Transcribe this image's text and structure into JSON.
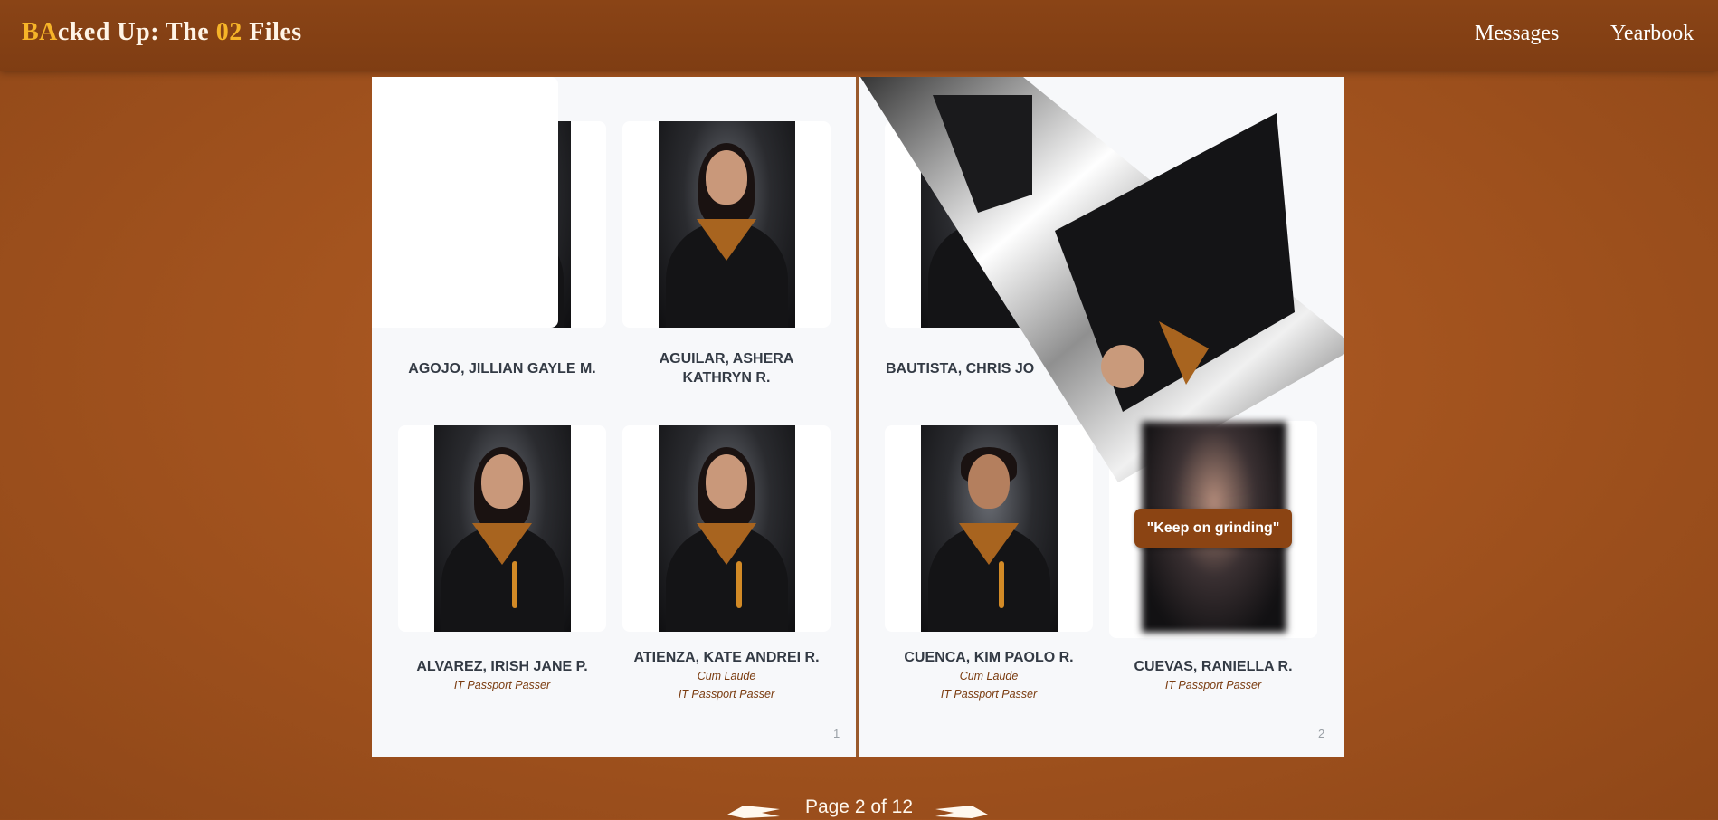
{
  "header": {
    "brand_part1": "BA",
    "brand_part2": "cked Up: The ",
    "brand_part3": "02",
    "brand_part4": " Files",
    "nav_messages": "Messages",
    "nav_yearbook": "Yearbook"
  },
  "left_page": {
    "page_number": "1",
    "students": [
      {
        "name_line1": "AGOJO, JILLIAN GAYLE M.",
        "name_line2": "",
        "honors": []
      },
      {
        "name_line1": "AGUILAR, ASHERA",
        "name_line2": "KATHRYN R.",
        "honors": []
      },
      {
        "name_line1": "ALVAREZ, IRISH JANE P.",
        "name_line2": "",
        "honors": [
          "IT Passport Passer"
        ]
      },
      {
        "name_line1": "ATIENZA, KATE ANDREI R.",
        "name_line2": "",
        "honors": [
          "Cum Laude",
          "IT Passport Passer"
        ]
      }
    ]
  },
  "right_page": {
    "page_number": "2",
    "students": [
      {
        "name_visible": "BAUTISTA, CHRIS JO",
        "honors": []
      },
      {
        "name_visible": "",
        "honors": []
      },
      {
        "name_line1": "CUENCA, KIM PAOLO R.",
        "honors": [
          "Cum Laude",
          "IT Passport Passer"
        ]
      },
      {
        "name_line1": "CUEVAS, RANIELLA R.",
        "honors": [
          "IT Passport Passer"
        ],
        "tooltip": "\"Keep on grinding\""
      }
    ]
  },
  "pager": {
    "label": "Page 2 of 12"
  },
  "colors": {
    "background": "#a4541f",
    "topbar": "#8a4416",
    "accent": "#f6b428",
    "tooltip_bg": "#8b4413"
  },
  "icons": [
    "prev-arrow-icon",
    "next-arrow-icon",
    "page-curl"
  ]
}
